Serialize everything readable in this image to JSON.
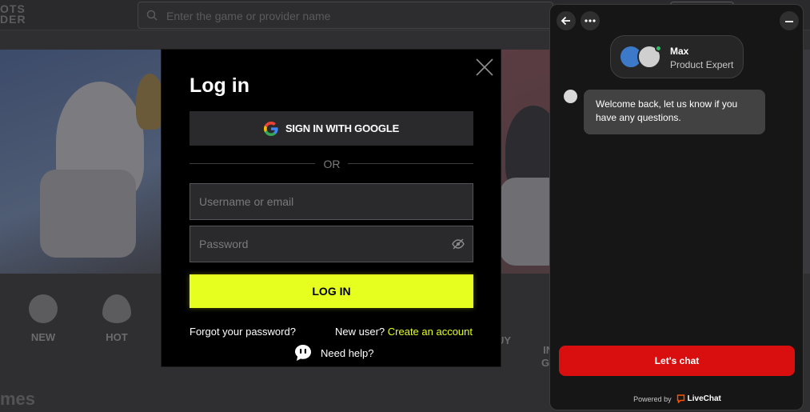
{
  "site": {
    "logo_line1": "OTS",
    "logo_line2": "DER",
    "search_placeholder": "Enter the game or provider name",
    "categories": [
      {
        "label": "NEW"
      },
      {
        "label": "HOT"
      },
      {
        "label": "UY"
      },
      {
        "label": "IN\nG"
      }
    ],
    "games_heading": "mes"
  },
  "login": {
    "title": "Log in",
    "google_label": "SIGN IN WITH GOOGLE",
    "divider": "OR",
    "username_placeholder": "Username or email",
    "password_placeholder": "Password",
    "submit_label": "LOG IN",
    "forgot_label": "Forgot your password?",
    "new_user_text": "New user?",
    "create_account_label": "Create an account",
    "help_label": "Need help?"
  },
  "chat": {
    "agent_name": "Max",
    "agent_role": "Product Expert",
    "message": "Welcome back, let us know if you have any questions.",
    "cta_label": "Let's chat",
    "powered_by": "Powered by",
    "brand": "LiveChat"
  },
  "colors": {
    "accent": "#e6ff1e",
    "chat_cta": "#d90f0f",
    "online": "#2dbd63"
  },
  "icons": {
    "close": "close-icon",
    "google": "google-icon",
    "eye": "eye-off-icon",
    "help": "chat-bubble-icon",
    "back": "arrow-left-icon",
    "more": "more-dots-icon",
    "minimize": "minimize-icon",
    "search": "search-icon"
  }
}
